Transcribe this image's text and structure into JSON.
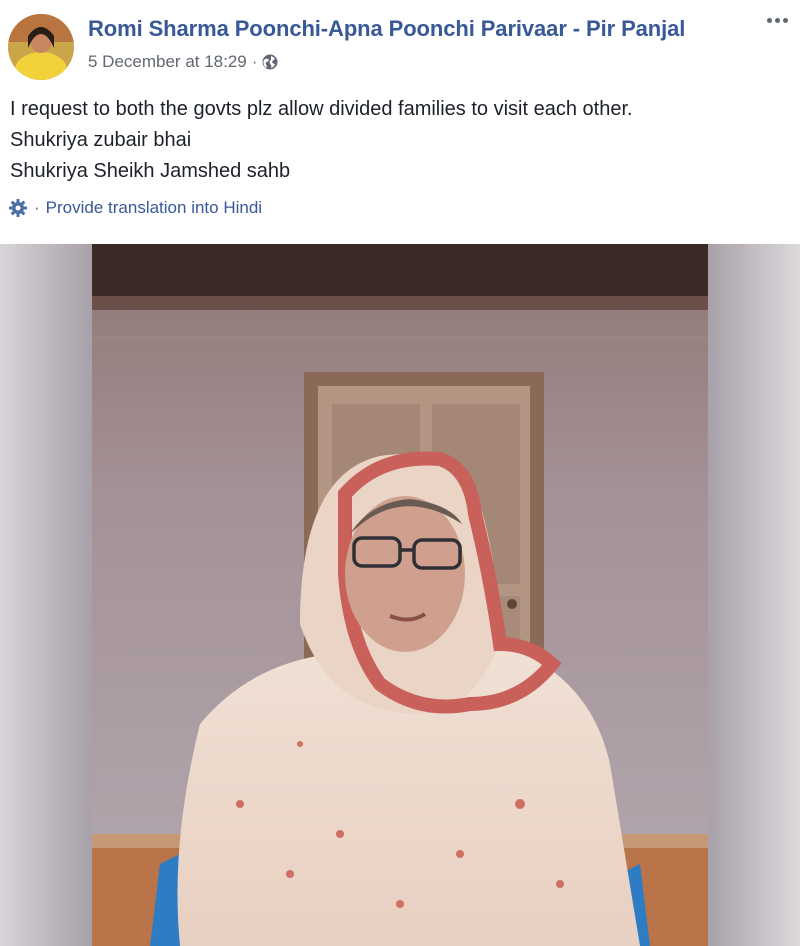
{
  "post": {
    "author": "Romi Sharma Poonchi-Apna Poonchi Parivaar - Pir Panjal",
    "timestamp": "5 December at 18:29",
    "separator": "·",
    "privacy_icon": "globe-icon",
    "message_lines": [
      "I request to both the govts plz allow divided families to visit each other.",
      "Shukriya zubair bhai",
      "Shukriya Sheikh Jamshed sahb"
    ],
    "translation": {
      "separator": "·",
      "link": "Provide translation into Hindi",
      "icon": "gear-icon"
    },
    "more_icon": "more-options-icon"
  },
  "colors": {
    "link_blue": "#385898",
    "meta_grey": "#616770",
    "text": "#1d2129"
  }
}
